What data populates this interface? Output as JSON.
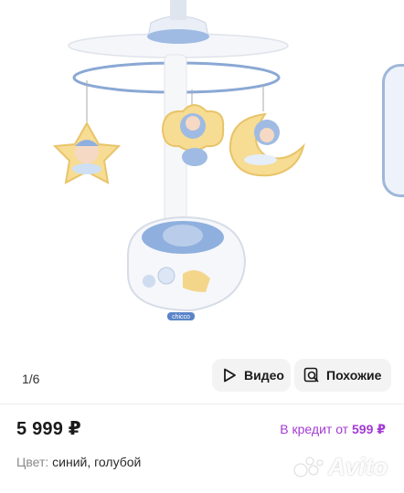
{
  "gallery": {
    "counter": "1/6",
    "video_label": "Видео",
    "similar_label": "Похожие",
    "brand_sticker": "chicco"
  },
  "listing": {
    "price": "5 999 ₽",
    "credit_prefix": "В кредит от",
    "credit_amount": "599 ₽",
    "color_label": "Цвет:",
    "color_value": "синий, голубой"
  },
  "watermark": "Avito",
  "colors": {
    "credit": "#a43bd3",
    "pill_bg": "#f3f3f3",
    "toy_blue": "#8fb0de",
    "toy_yellow": "#f3d68a"
  }
}
